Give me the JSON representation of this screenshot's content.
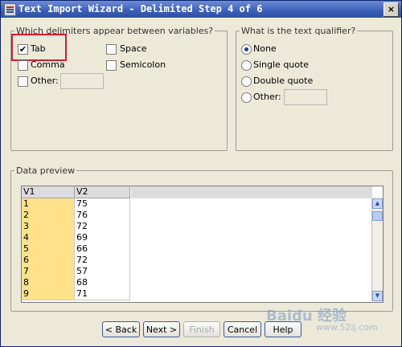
{
  "window": {
    "title": "Text Import Wizard - Delimited Step 4 of 6",
    "close_label": "×"
  },
  "delimiters": {
    "legend": "Which delimiters appear between variables?",
    "tab": {
      "label": "Tab",
      "checked": true,
      "check_glyph": "✔"
    },
    "comma": {
      "label": "Comma",
      "checked": false
    },
    "other": {
      "label": "Other:",
      "checked": false,
      "value": ""
    },
    "space": {
      "label": "Space",
      "checked": false
    },
    "semicolon": {
      "label": "Semicolon",
      "checked": false
    }
  },
  "qualifier": {
    "legend": "What is the text qualifier?",
    "options": [
      {
        "label": "None",
        "selected": true
      },
      {
        "label": "Single quote",
        "selected": false
      },
      {
        "label": "Double quote",
        "selected": false
      },
      {
        "label": "Other:",
        "selected": false
      }
    ],
    "other_value": ""
  },
  "preview": {
    "legend": "Data preview",
    "columns": [
      "V1",
      "V2"
    ],
    "rows": [
      [
        "1",
        "75"
      ],
      [
        "2",
        "76"
      ],
      [
        "3",
        "72"
      ],
      [
        "4",
        "69"
      ],
      [
        "5",
        "66"
      ],
      [
        "6",
        "72"
      ],
      [
        "7",
        "57"
      ],
      [
        "8",
        "68"
      ],
      [
        "9",
        "71"
      ]
    ],
    "scroll_up": "▲",
    "scroll_down": "▼"
  },
  "buttons": {
    "back": "< Back",
    "next": "Next >",
    "finish": "Finish",
    "cancel": "Cancel",
    "help": "Help"
  },
  "watermark": {
    "main": "Baidu 经验",
    "sub": "www.52ij.com"
  }
}
